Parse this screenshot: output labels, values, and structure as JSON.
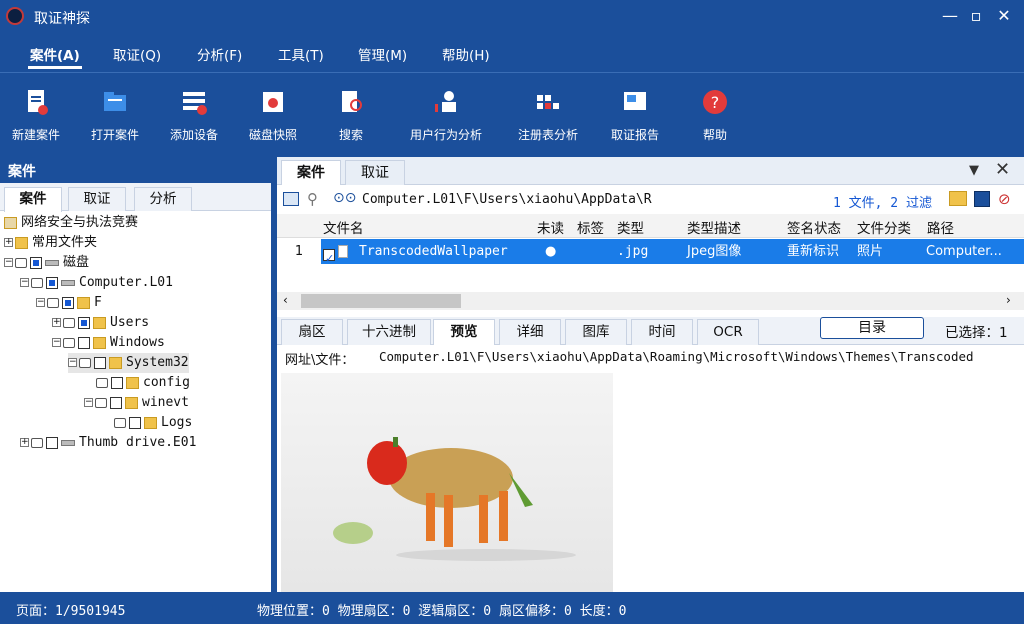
{
  "app": {
    "title": "取证神探"
  },
  "menu": [
    "案件(A)",
    "取证(Q)",
    "分析(F)",
    "工具(T)",
    "管理(M)",
    "帮助(H)"
  ],
  "toolbar": [
    "新建案件",
    "打开案件",
    "添加设备",
    "磁盘快照",
    "搜索",
    "用户行为分析",
    "注册表分析",
    "取证报告",
    "帮助"
  ],
  "left_panel": {
    "header": "案件",
    "tabs": [
      "案件",
      "取证",
      "分析"
    ],
    "tree": [
      "网络安全与执法竞赛",
      "常用文件夹",
      "磁盘",
      "Computer.L01",
      "F",
      "Users",
      "Windows",
      "System32",
      "config",
      "winevt",
      "Logs",
      "Thumb drive.E01"
    ]
  },
  "right_panel": {
    "tabs": [
      "案件",
      "取证"
    ],
    "path": "Computer.L01\\F\\Users\\xiaohu\\AppData\\R",
    "filter_info": "1 文件, 2 过滤",
    "columns": [
      "文件名",
      "未读",
      "标签",
      "类型",
      "类型描述",
      "签名状态",
      "文件分类",
      "路径"
    ],
    "row": {
      "index": "1",
      "filename": "TranscodedWallpaper",
      "type": ".jpg",
      "type_desc": "Jpeg图像",
      "signature": "重新标识",
      "category": "照片",
      "path": "Computer..."
    },
    "preview_tabs": [
      "扇区",
      "十六进制",
      "预览",
      "详细",
      "图库",
      "时间",
      "OCR"
    ],
    "dir_button": "目录",
    "selected": "已选择：1",
    "url_label": "网址\\文件：",
    "url_value": "Computer.L01\\F\\Users\\xiaohu\\AppData\\Roaming\\Microsoft\\Windows\\Themes\\Transcoded"
  },
  "status": {
    "page": "页面：1/9501945",
    "info": "物理位置：0 物理扇区：0 逻辑扇区：0 扇区偏移：0 长度：0"
  },
  "colors": {
    "primary": "#1b4f9b",
    "selection": "#1a7ce8"
  }
}
